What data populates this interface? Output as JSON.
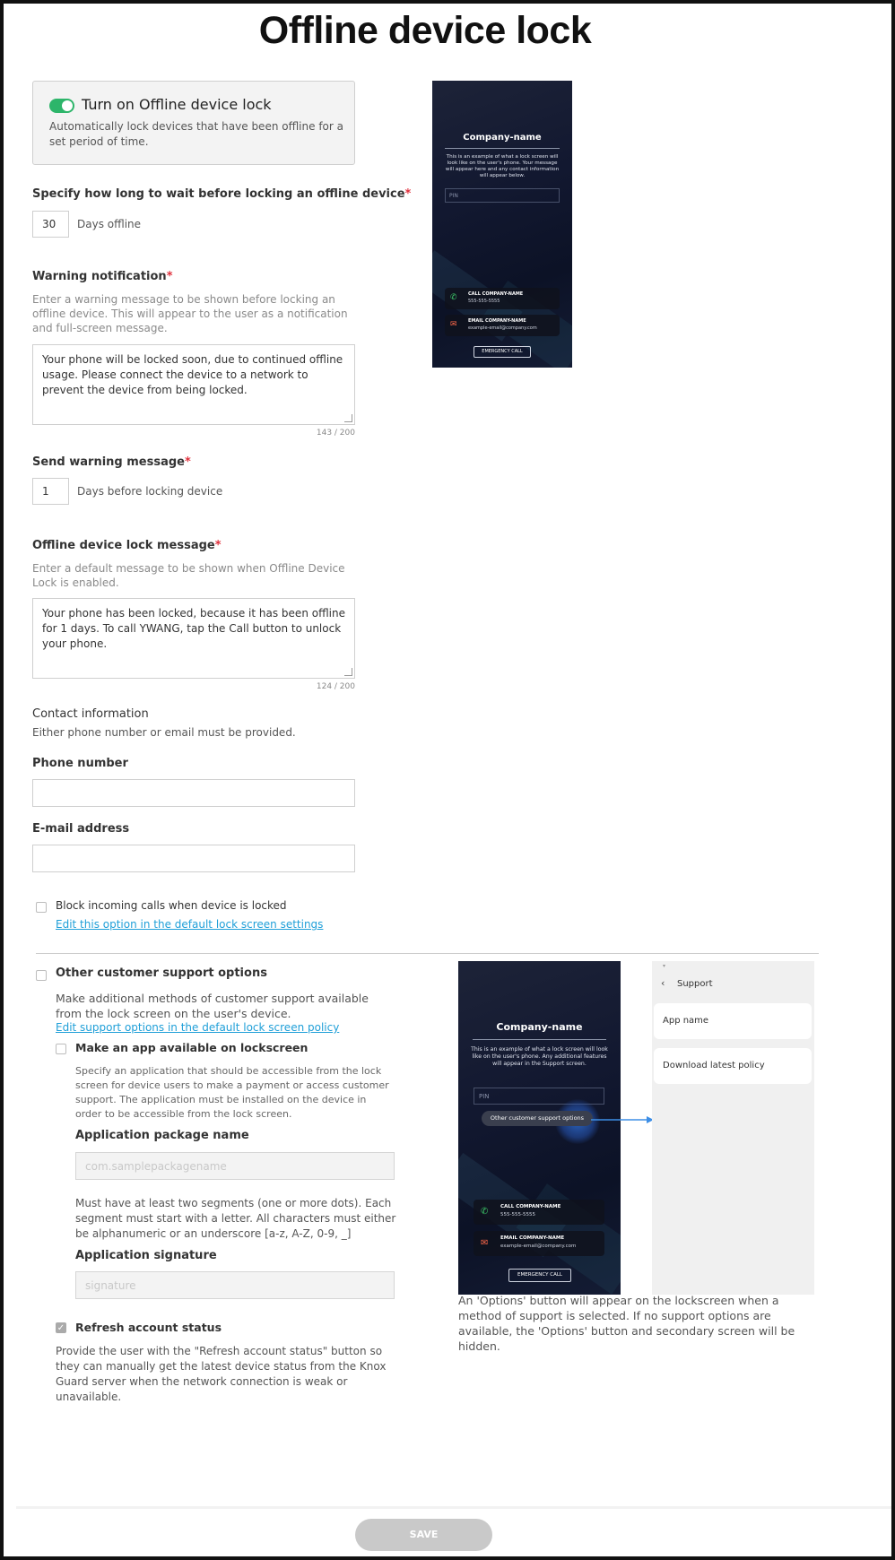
{
  "page_title": "Offline device lock",
  "toggle_card": {
    "title": "Turn on Offline device lock",
    "description": "Automatically lock devices that have been offline for a set period of time."
  },
  "wait": {
    "label": "Specify how long to wait before locking an offline device",
    "required_mark": "*",
    "value": "30",
    "unit": "Days offline"
  },
  "warning": {
    "label": "Warning notification",
    "required_mark": "*",
    "help": "Enter a warning message to be shown before locking an offline device. This will appear to the user as a notification and full-screen message.",
    "value": "Your phone will be locked soon, due to continued offline usage. Please connect the device to a network to prevent the device from being locked.",
    "counter": "143 / 200"
  },
  "send_warning": {
    "label": "Send warning message",
    "required_mark": "*",
    "value": "1",
    "unit": "Days before locking device"
  },
  "lock_message": {
    "label": "Offline device lock message",
    "required_mark": "*",
    "help": "Enter a default message to be shown when Offline Device Lock is enabled.",
    "value": "Your phone has been locked, because it has been offline for 1 days. To call YWANG, tap the Call button to unlock your phone.",
    "counter": "124 / 200"
  },
  "contact": {
    "label": "Contact information",
    "help": "Either phone number or email must be provided.",
    "phone_label": "Phone number",
    "email_label": "E-mail address"
  },
  "block_calls": {
    "label": "Block incoming calls when device is locked",
    "link": "Edit this option in the default lock screen settings"
  },
  "support_options": {
    "label": "Other customer support options",
    "description": "Make additional methods of customer support available from the lock screen on the user's device.",
    "link": "Edit support options in the default lock screen policy",
    "app_checkbox": "Make an app available on lockscreen",
    "app_help": "Specify an application that should be accessible from the lock screen for device users to make a payment or access customer support. The application must be installed on the device in order to be accessible from the lock screen.",
    "package_label": "Application package name",
    "package_placeholder": "com.samplepackagename",
    "package_rule": "Must have at least two segments (one or more dots). Each segment must start with a letter. All characters must either be alphanumeric or an underscore [a-z, A-Z, 0-9, _]",
    "signature_label": "Application signature",
    "signature_placeholder": "signature",
    "refresh_label": "Refresh account status",
    "refresh_checked": true,
    "refresh_help": "Provide the user with the \"Refresh account status\" button so they can manually get the latest device status from the Knox Guard server when the network connection is weak or unavailable."
  },
  "preview1": {
    "company": "Company-name",
    "desc": "This is an example of what a lock screen will look like on the user's phone. Your message will appear here and any contact information will appear below.",
    "pin": "PIN",
    "call_title": "CALL COMPANY-NAME",
    "call_value": "555-555-5555",
    "email_title": "EMAIL COMPANY-NAME",
    "email_value": "example-email@company.com",
    "emergency": "EMERGENCY CALL"
  },
  "preview2": {
    "company": "Company-name",
    "desc": "This is an example of what a lock screen will look like on the user's phone. Any additional features will appear in the Support screen.",
    "pin": "PIN",
    "options_button": "Other customer support options",
    "call_title": "CALL COMPANY-NAME",
    "call_value": "555-555-5555",
    "email_title": "EMAIL COMPANY-NAME",
    "email_value": "example-email@company.com",
    "emergency": "EMERGENCY CALL"
  },
  "support_screen": {
    "title": "Support",
    "items": [
      "App name",
      "Download latest policy"
    ]
  },
  "preview_caption": "An 'Options' button will appear on the lockscreen when a method of support is selected. If no support options are available, the 'Options' button and secondary screen will be hidden.",
  "save_label": "SAVE",
  "colors": {
    "toggle_on": "#2db56a",
    "required": "#e0313d",
    "link": "#1f9fd8",
    "arrow": "#3d8ee6"
  },
  "icons": [
    "phone-icon",
    "mail-icon",
    "chevron-left-icon",
    "checkmark-icon"
  ]
}
